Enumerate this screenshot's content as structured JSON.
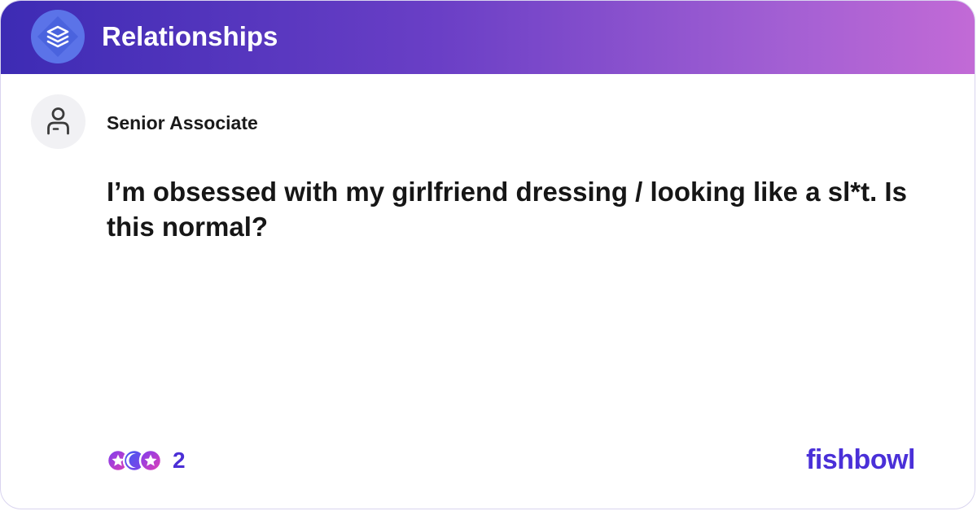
{
  "header": {
    "channel_name": "Relationships",
    "logo_icon": "stacked-layers-icon",
    "gradient_start": "#3d2bb4",
    "gradient_end": "#c26ad6"
  },
  "post": {
    "author": "Senior Associate",
    "avatar_icon": "person-icon",
    "title": "I’m obsessed with my girlfriend dressing / looking like a sl*t. Is this normal?"
  },
  "footer": {
    "reaction_icons": [
      "star-reaction-icon",
      "moon-reaction-icon",
      "star-reaction-icon"
    ],
    "reaction_count": "2",
    "brand": "fishbowl",
    "brand_color": "#4a30d8"
  }
}
